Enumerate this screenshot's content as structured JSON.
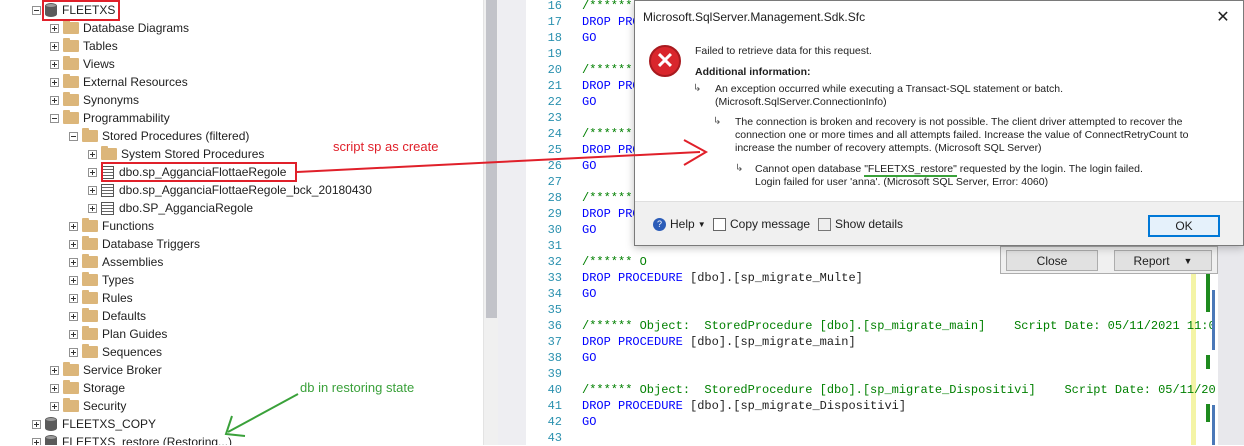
{
  "explorer": {
    "nodes": [
      {
        "label": "FLEETXS",
        "icon": "database-icon"
      },
      {
        "label": "Database Diagrams",
        "icon": "folder-icon"
      },
      {
        "label": "Tables",
        "icon": "folder-icon"
      },
      {
        "label": "Views",
        "icon": "folder-icon"
      },
      {
        "label": "External Resources",
        "icon": "folder-icon"
      },
      {
        "label": "Synonyms",
        "icon": "folder-icon"
      },
      {
        "label": "Programmability",
        "icon": "folder-icon"
      },
      {
        "label": "Stored Procedures (filtered)",
        "icon": "folder-icon"
      },
      {
        "label": "System Stored Procedures",
        "icon": "folder-icon"
      },
      {
        "label": "dbo.sp_AgganciaFlottaeRegole",
        "icon": "stored-procedure-icon"
      },
      {
        "label": "dbo.sp_AgganciaFlottaeRegole_bck_20180430",
        "icon": "stored-procedure-icon"
      },
      {
        "label": "dbo.SP_AgganciaRegole",
        "icon": "stored-procedure-icon"
      },
      {
        "label": "Functions",
        "icon": "folder-icon"
      },
      {
        "label": "Database Triggers",
        "icon": "folder-icon"
      },
      {
        "label": "Assemblies",
        "icon": "folder-icon"
      },
      {
        "label": "Types",
        "icon": "folder-icon"
      },
      {
        "label": "Rules",
        "icon": "folder-icon"
      },
      {
        "label": "Defaults",
        "icon": "folder-icon"
      },
      {
        "label": "Plan Guides",
        "icon": "folder-icon"
      },
      {
        "label": "Sequences",
        "icon": "folder-icon"
      },
      {
        "label": "Service Broker",
        "icon": "folder-icon"
      },
      {
        "label": "Storage",
        "icon": "folder-icon"
      },
      {
        "label": "Security",
        "icon": "folder-icon"
      },
      {
        "label": "FLEETXS_COPY",
        "icon": "database-icon"
      },
      {
        "label": "FLEETXS_restore (Restoring...)",
        "icon": "database-icon"
      }
    ]
  },
  "annotations": {
    "script_note": "script sp as create",
    "db_note": "db in restoring state"
  },
  "editor": {
    "line_numbers": [
      "16",
      "17",
      "18",
      "19",
      "20",
      "21",
      "22",
      "23",
      "24",
      "25",
      "26",
      "27",
      "28",
      "29",
      "30",
      "31",
      "32",
      "33",
      "34",
      "35",
      "36",
      "37",
      "38",
      "39",
      "40",
      "41",
      "42",
      "43"
    ],
    "lines": {
      "l16": "/******",
      "l17a": "DROP",
      "l17b": " PROC",
      "l18": "GO",
      "l20": "/******",
      "l21a": "DROP",
      "l21b": " PROC",
      "l22": "GO",
      "l24": "/******",
      "l25a": "DROP",
      "l25b": " PROC",
      "l26": "GO",
      "l28": "/******",
      "l29a": "DROP",
      "l29b": " PROC",
      "l30": "GO",
      "l32": "/****** O",
      "l33a": "DROP PROCEDURE",
      "l33b": " [dbo].[sp_migrate_Multe]",
      "l34": "GO",
      "l36": "/****** Object:  StoredProcedure [dbo].[sp_migrate_main]    Script Date: 05/11/2021 11:0",
      "l37a": "DROP PROCEDURE",
      "l37b": " [dbo].[sp_migrate_main]",
      "l38": "GO",
      "l40": "/****** Object:  StoredProcedure [dbo].[sp_migrate_Dispositivi]    Script Date: 05/11/20",
      "l41a": "DROP PROCEDURE",
      "l41b": " [dbo].[sp_migrate_Dispositivi]",
      "l42": "GO"
    }
  },
  "dialog": {
    "title": "Microsoft.SqlServer.Management.Sdk.Sfc",
    "close_glyph": "✕",
    "error_glyph": "✕",
    "message": "Failed to retrieve data for this request.",
    "additional_info_label": "Additional information:",
    "info1_line1": "An exception occurred while executing a Transact-SQL statement or batch.",
    "info1_line2": "(Microsoft.SqlServer.ConnectionInfo)",
    "info2_line1": "The connection is broken and recovery is not possible.  The client driver attempted to recover the",
    "info2_line2": "connection one or more times and all attempts failed.  Increase the value of ConnectRetryCount to",
    "info2_line3": "increase the number of recovery attempts. (Microsoft SQL Server)",
    "info3_line1_pre": "Cannot open database ",
    "info3_line1_db": "\"FLEETXS_restore\"",
    "info3_line1_post": " requested by the login. The login failed.",
    "info3_line2": "Login failed for user 'anna'. (Microsoft SQL Server, Error: 4060)",
    "help_label": "Help",
    "copy_label": "Copy message",
    "details_label": "Show details",
    "ok_label": "OK"
  },
  "back_dialog": {
    "close_label": "Close",
    "report_label": "Report"
  },
  "colors": {
    "annotation_red": "#e0202a",
    "annotation_green": "#3aa13a",
    "keyword": "#0000ff",
    "comment": "#008000",
    "line_number": "#2b91af"
  }
}
